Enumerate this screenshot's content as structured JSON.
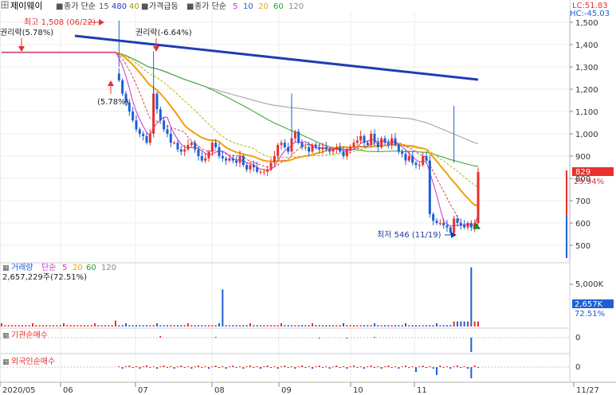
{
  "header": {
    "symbol_icon": "grid-icon",
    "symbol": "제이웨이",
    "ma_label": "종가 단순",
    "ma_values": [
      "15",
      "480",
      "40"
    ],
    "signal_label": "가격급등",
    "ma2_label": "종가 단순",
    "ma2_values": [
      "5",
      "10",
      "20",
      "60",
      "120"
    ],
    "lc": "LC:51.83",
    "hc": "HC:-45.03"
  },
  "annotations": {
    "high": "최고 1,508 (06/22)",
    "low": "최저 546 (11/19)",
    "rights_left": "권리락(5.78%)",
    "rights_right": "권리락(-6.64%)",
    "pct_marker": "(5.78%)"
  },
  "price_badges": {
    "current": "829",
    "change": "29.94%"
  },
  "volume_panel": {
    "title": "거래량",
    "ma_label": "단순",
    "ma_values": [
      "5",
      "20",
      "60",
      "120"
    ],
    "volume_text": "2,657,229주(72.51%)",
    "badge_value": "2,657K",
    "badge_pct": "72.51%",
    "axis_label": "5,000K"
  },
  "institution_panel": {
    "title": "기관순매수",
    "zero": "0"
  },
  "foreign_panel": {
    "title": "외국인순매수",
    "zero": "0"
  },
  "colors": {
    "up": "#e8302c",
    "down": "#1e5fd6",
    "trend": "#1f3db5",
    "ma_orange": "#f0a010",
    "ma_green": "#27a12e",
    "ma_gray": "#9a9a9a",
    "ma_magenta": "#cc33cc",
    "ma_red_dash": "#d44a3a"
  },
  "chart_data": {
    "type": "candlestick",
    "x_ticks": [
      "2020/05",
      "06",
      "07",
      "08",
      "09",
      "10",
      "11",
      "11/27"
    ],
    "y_ticks": [
      1500,
      1400,
      1300,
      1200,
      1100,
      1000,
      900,
      800,
      700,
      600,
      500
    ],
    "ylim": [
      440,
      1560
    ],
    "high": 1508,
    "high_date": "06/22",
    "low": 546,
    "low_date": "11/19",
    "last_close": 829,
    "close_path": [
      1365,
      1365,
      1365,
      1365,
      1365,
      1365,
      1365,
      1365,
      1365,
      1365,
      1365,
      1365,
      1365,
      1365,
      1365,
      1365,
      1365,
      1365,
      1365,
      1365,
      1365,
      1365,
      1365,
      1365,
      1365,
      1365,
      1365,
      1365,
      1365,
      1365,
      1365,
      1365,
      1365,
      1365,
      1240,
      1180,
      1140,
      1100,
      1060,
      1020,
      1000,
      990,
      960,
      1000,
      1180,
      1110,
      1060,
      1020,
      1000,
      960,
      960,
      930,
      920,
      930,
      950,
      960,
      930,
      900,
      880,
      890,
      920,
      960,
      940,
      900,
      890,
      880,
      890,
      880,
      870,
      900,
      860,
      840,
      860,
      850,
      830,
      830,
      830,
      840,
      870,
      900,
      950,
      960,
      940,
      920,
      980,
      1010,
      960,
      940,
      940,
      920,
      950,
      940,
      930,
      940,
      930,
      920,
      930,
      940,
      920,
      900,
      930,
      940,
      960,
      970,
      990,
      960,
      950,
      1000,
      960,
      940,
      980,
      960,
      950,
      980,
      950,
      920,
      910,
      880,
      900,
      870,
      860,
      860,
      900,
      880,
      640,
      610,
      600,
      600,
      590,
      580,
      556,
      620,
      600,
      590,
      580,
      600,
      580,
      600,
      829
    ],
    "trend_line": [
      [
        1508,
        1240
      ]
    ],
    "moving_averages": [
      "5",
      "10",
      "20",
      "60",
      "120"
    ],
    "volume_peaks_k": [
      7000,
      4400,
      4300,
      4400,
      2657
    ]
  }
}
